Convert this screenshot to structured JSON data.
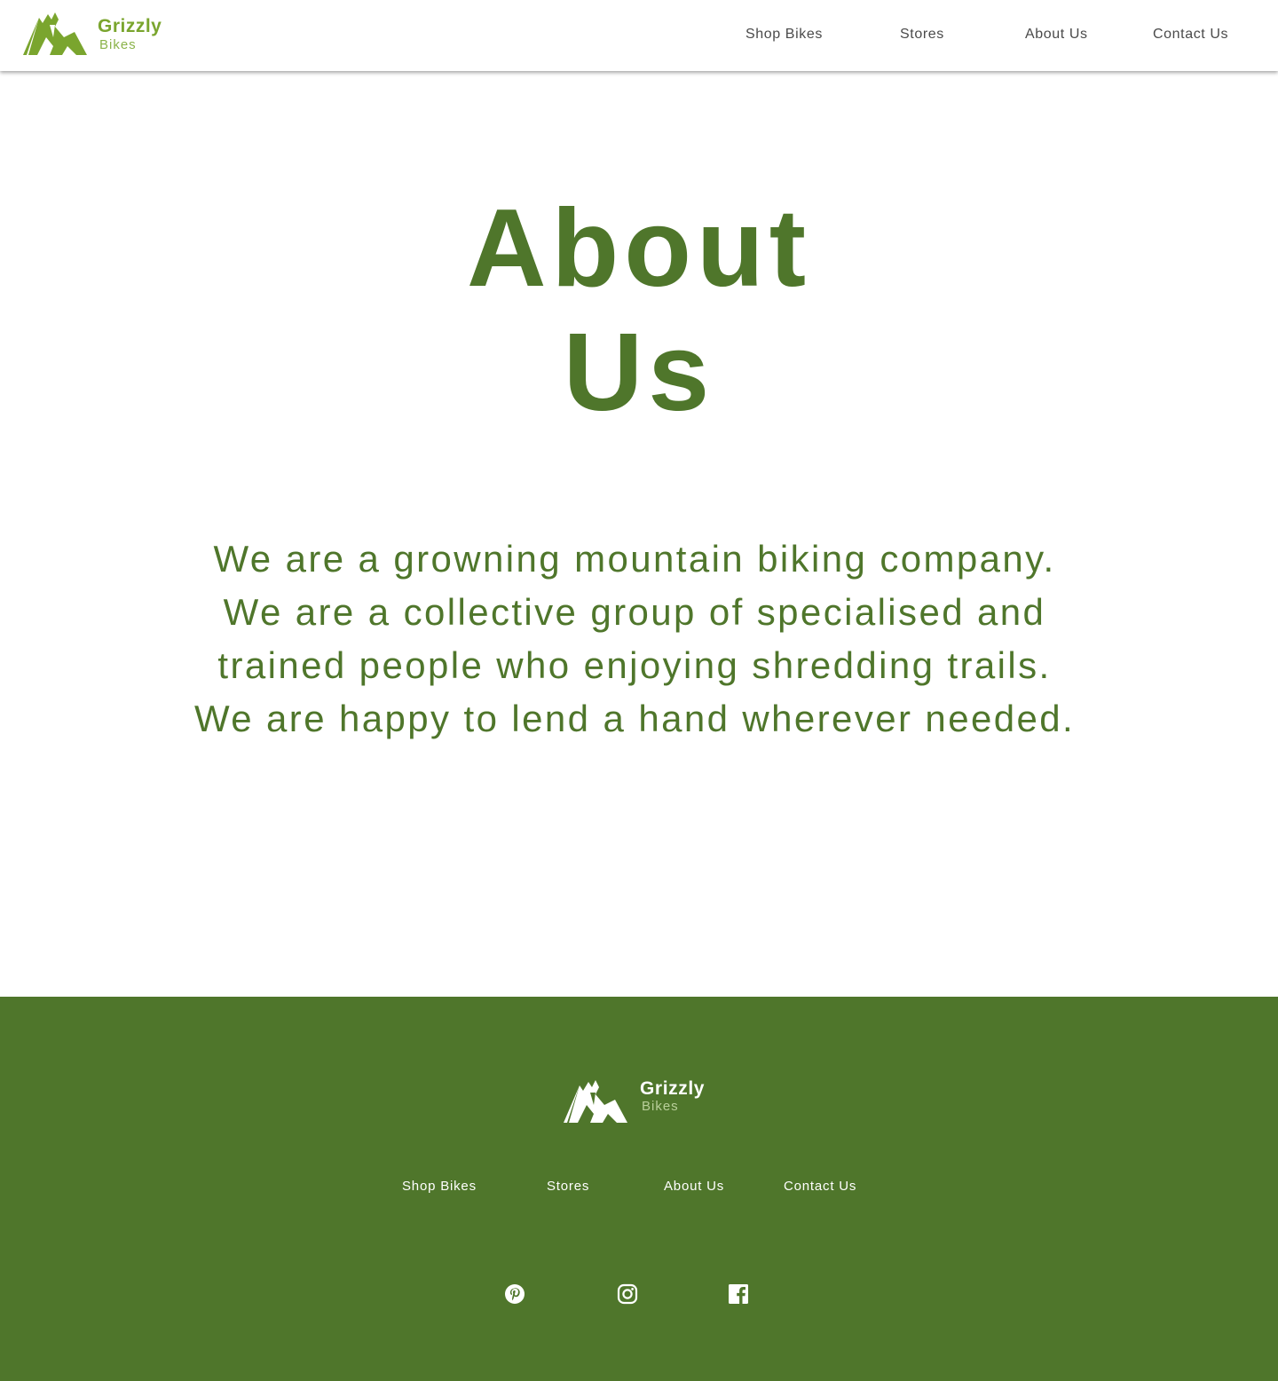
{
  "brand": {
    "name": "Grizzly",
    "tagline": "Bikes"
  },
  "header": {
    "nav": [
      "Shop Bikes",
      "Stores",
      "About Us",
      "Contact Us"
    ]
  },
  "main": {
    "title_line1": "About",
    "title_line2": "Us",
    "body": "We are a growning mountain biking company. We are a collective group of specialised and trained people who enjoying shredding trails. We are happy to lend a hand wherever needed."
  },
  "footer": {
    "nav": [
      "Shop Bikes",
      "Stores",
      "About Us",
      "Contact Us"
    ],
    "social": [
      "pinterest-icon",
      "instagram-icon",
      "facebook-icon"
    ]
  },
  "colors": {
    "primary_green": "#4f762b",
    "logo_green": "#7aa52e",
    "white": "#ffffff"
  }
}
